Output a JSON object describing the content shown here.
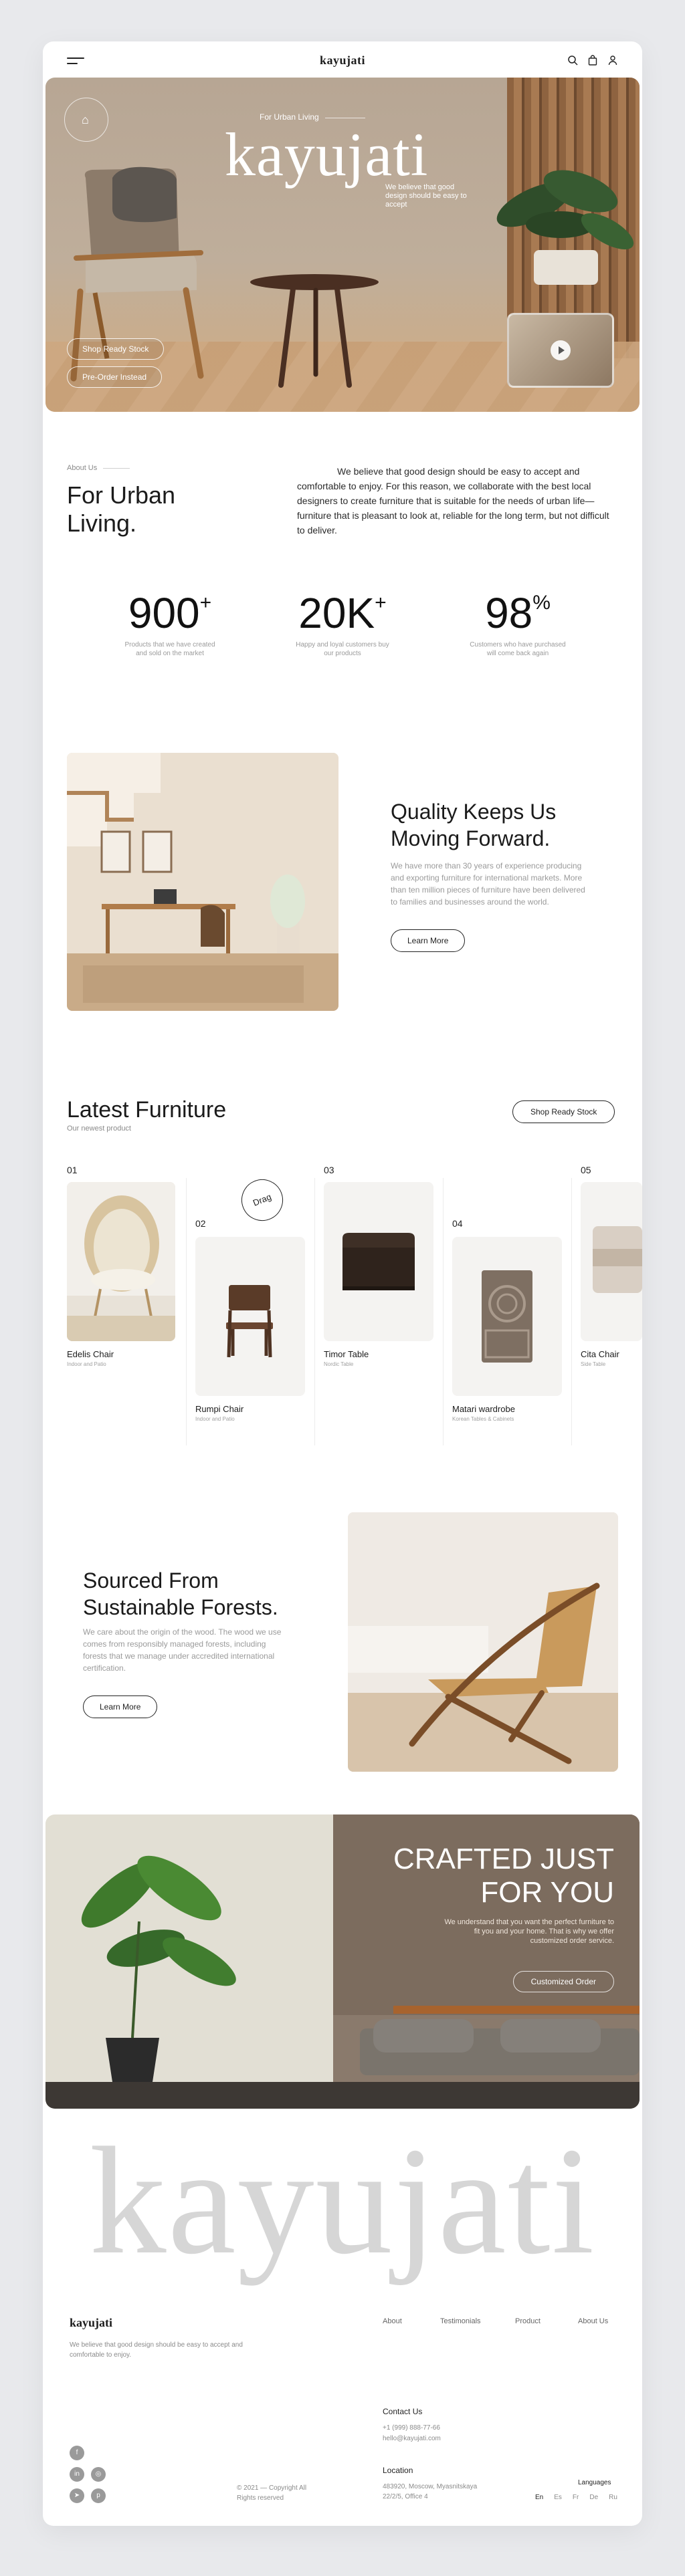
{
  "nav": {
    "logo": "kayujati"
  },
  "hero": {
    "subtitle": "For Urban Living",
    "title": "kayujati",
    "tagline": "We believe that good design should be easy to accept",
    "btn_primary": "Shop Ready Stock",
    "btn_secondary": "Pre-Order Instead"
  },
  "about": {
    "label": "About Us",
    "title": "For Urban Living.",
    "text": "We believe that good design should be easy to accept and comfortable to enjoy. For this reason, we collaborate with the best local designers to create furniture that is suitable for the needs of urban life—furniture that is pleasant to look at, reliable for the long term, but not difficult to deliver."
  },
  "stats": [
    {
      "value": "900",
      "suffix": "+",
      "desc": "Products that we have created and sold on the market"
    },
    {
      "value": "20K",
      "suffix": "+",
      "desc": "Happy and loyal customers buy our products"
    },
    {
      "value": "98",
      "suffix": "%",
      "desc": "Customers who have purchased will come back again"
    }
  ],
  "quality": {
    "title": "Quality Keeps Us Moving Forward.",
    "text": "We have more than 30 years of experience producing and exporting furniture for international markets. More than ten million pieces of furniture have been delivered to families and businesses around the world.",
    "button": "Learn More"
  },
  "latest": {
    "title": "Latest Furniture",
    "subtitle": "Our newest product",
    "button": "Shop Ready Stock",
    "drag": "Drag",
    "items": [
      {
        "num": "01",
        "name": "Edelis Chair",
        "cat": "Indoor and Patio"
      },
      {
        "num": "02",
        "name": "Rumpi Chair",
        "cat": "Indoor and Patio"
      },
      {
        "num": "03",
        "name": "Timor Table",
        "cat": "Nordic Table"
      },
      {
        "num": "04",
        "name": "Matari wardrobe",
        "cat": "Korean Tables & Cabinets"
      },
      {
        "num": "05",
        "name": "Cita Chair",
        "cat": "Side Table"
      }
    ]
  },
  "sourced": {
    "title": "Sourced From Sustainable Forests.",
    "text": "We care about the origin of the wood. The wood we use comes from responsibly managed forests, including forests that we manage under accredited international certification.",
    "button": "Learn More"
  },
  "crafted": {
    "title": "CRAFTED JUST FOR YOU",
    "text": "We understand that you want the perfect furniture to fit you and your home. That is why we offer customized order service.",
    "button": "Customized Order"
  },
  "big_word": "kayujati",
  "footer": {
    "logo": "kayujati",
    "tagline": "We believe that good design should be easy to accept and comfortable to enjoy.",
    "links": [
      "About",
      "Testimonials",
      "Product",
      "About Us"
    ],
    "contact_title": "Contact Us",
    "phone": "+1 (999) 888-77-66",
    "email": "hello@kayujati.com",
    "location_title": "Location",
    "address": "483920, Moscow, Myasnitskaya 22/2/5, Office 4",
    "copyright": "© 2021 — Copyright All Rights reserved",
    "languages_title": "Languages",
    "languages": [
      "En",
      "Es",
      "Fr",
      "De",
      "Ru"
    ]
  }
}
